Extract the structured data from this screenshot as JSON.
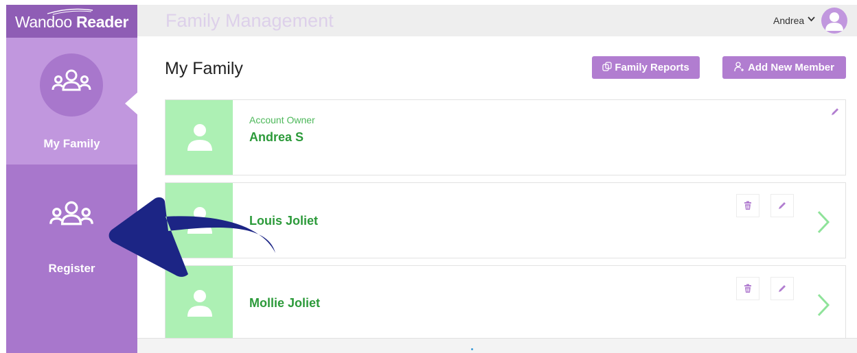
{
  "sidebar": {
    "logo": {
      "part1": "Wandoo",
      "part2": "Reader"
    },
    "items": [
      {
        "label": "My Family",
        "icon": "family-group-icon",
        "active": true
      },
      {
        "label": "Register",
        "icon": "family-group-icon",
        "active": false
      }
    ]
  },
  "header": {
    "title": "Family Management",
    "user": "Andrea",
    "user_icon": "user-avatar-icon"
  },
  "main": {
    "heading": "My Family",
    "actions": {
      "reports_label": "Family Reports",
      "add_label": "Add New Member"
    },
    "members": [
      {
        "role": "Account Owner",
        "name": "Andrea S"
      },
      {
        "role": "",
        "name": "Louis Joliet"
      },
      {
        "role": "",
        "name": "Mollie Joliet"
      }
    ]
  },
  "colors": {
    "sidebar": "#a877cc",
    "sidebar_active": "#c197de",
    "button": "#b17dd0",
    "member_name": "#2c9a3a",
    "thumb": "#adf0b4",
    "annotation_arrow": "#1c2585"
  }
}
